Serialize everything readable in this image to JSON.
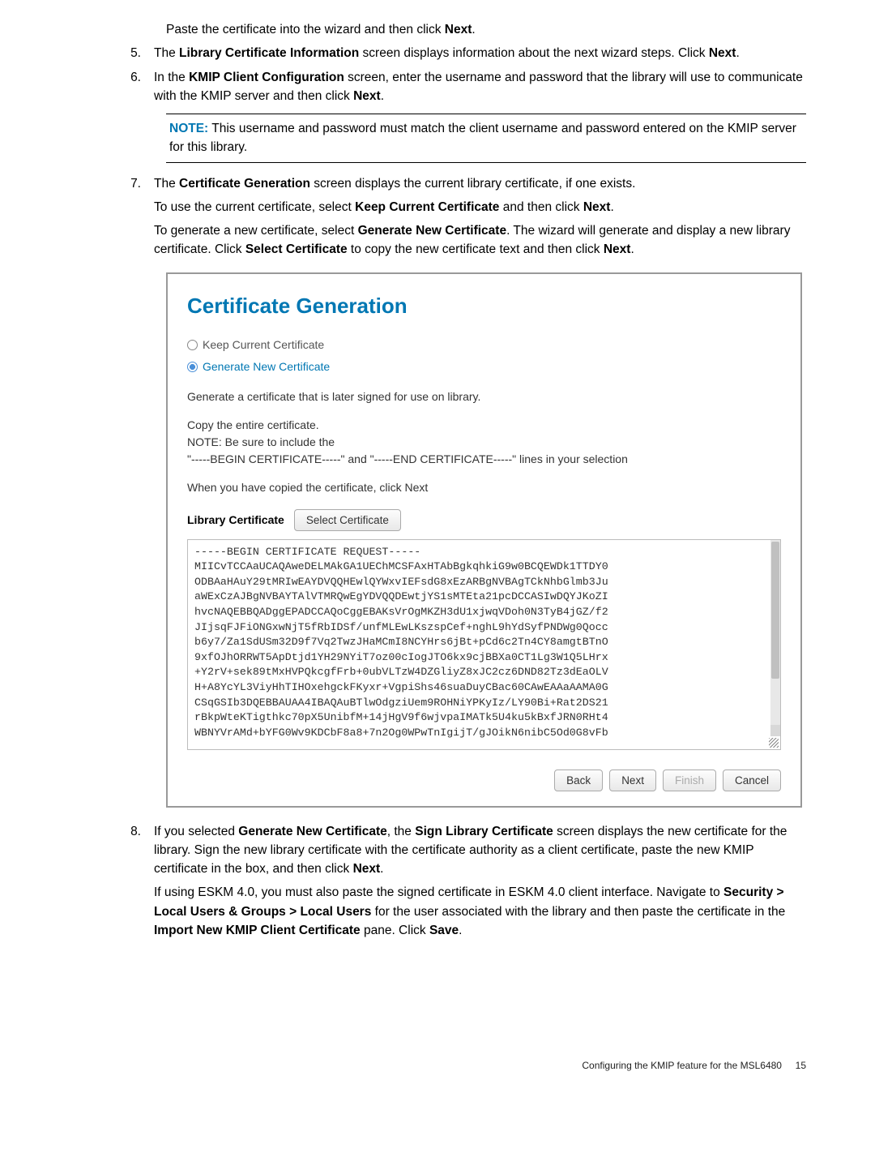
{
  "intro": {
    "t1": "Paste the certificate into the wizard and then click ",
    "next": "Next",
    "t2": "."
  },
  "item5": {
    "num": "5.",
    "t1": "The ",
    "b1": "Library Certificate Information",
    "t2": " screen displays information about the next wizard steps. Click ",
    "b2": "Next",
    "t3": "."
  },
  "item6": {
    "num": "6.",
    "t1": "In the ",
    "b1": "KMIP Client Configuration",
    "t2": " screen, enter the username and password that the library will use to communicate with the KMIP server and then click ",
    "b2": "Next",
    "t3": "."
  },
  "note": {
    "label": "NOTE:",
    "text": " This username and password must match the client username and password entered on the KMIP server for this library."
  },
  "item7": {
    "num": "7.",
    "line1_t1": "The ",
    "line1_b1": "Certificate Generation",
    "line1_t2": " screen displays the current library certificate, if one exists.",
    "line2_t1": "To use the current certificate, select ",
    "line2_b1": "Keep Current Certificate",
    "line2_t2": " and then click ",
    "line2_b2": "Next",
    "line2_t3": ".",
    "line3_t1": "To generate a new certificate, select ",
    "line3_b1": "Generate New Certificate",
    "line3_t2": ". The wizard will generate and display a new library certificate. Click ",
    "line3_b2": "Select Certificate",
    "line3_t3": " to copy the new certificate text and then click ",
    "line3_b3": "Next",
    "line3_t4": "."
  },
  "cert": {
    "title": "Certificate Generation",
    "radio_keep": "Keep Current Certificate",
    "radio_gen": "Generate New Certificate",
    "sub1": "Generate a certificate that is later signed for use on library.",
    "sub2": "Copy the entire certificate.",
    "sub3": "NOTE: Be sure to include the",
    "sub4": "\"-----BEGIN CERTIFICATE-----\" and \"-----END CERTIFICATE-----\" lines in your selection",
    "sub5": "When you have copied the certificate, click Next",
    "libcert_label": "Library Certificate",
    "select_btn": "Select Certificate",
    "text": [
      "-----BEGIN CERTIFICATE REQUEST-----",
      "MIICvTCCAaUCAQAweDELMAkGA1UEChMCSFAxHTAbBgkqhkiG9w0BCQEWDk1TTDY0",
      "ODBAaHAuY29tMRIwEAYDVQQHEwlQYWxvIEFsdG8xEzARBgNVBAgTCkNhbGlmb3Ju",
      "aWExCzAJBgNVBAYTAlVTMRQwEgYDVQQDEwtjYS1sMTEta21pcDCCASIwDQYJKoZI",
      "hvcNAQEBBQADggEPADCCAQoCggEBAKsVrOgMKZH3dU1xjwqVDoh0N3TyB4jGZ/f2",
      "JIjsqFJFiONGxwNjT5fRbIDSf/unfMLEwLKszspCef+nghL9hYdSyfPNDWg0Qocc",
      "b6y7/Za1SdUSm32D9f7Vq2TwzJHaMCmI8NCYHrs6jBt+pCd6c2Tn4CY8amgtBTnO",
      "9xfOJhORRWT5ApDtjd1YH29NYiT7oz00cIogJTO6kx9cjBBXa0CT1Lg3W1Q5LHrx",
      "+Y2rV+sek89tMxHVPQkcgfFrb+0ubVLTzW4DZGliyZ8xJC2cz6DND82Tz3dEaOLV",
      "H+A8YcYL3ViyHhTIHOxehgckFKyxr+VgpiShs46suaDuyCBac60CAwEAAaAAMA0G",
      "CSqGSIb3DQEBBAUAA4IBAQAuBTlwOdgziUem9ROHNiYPKyIz/LY90Bi+Rat2DS21",
      "rBkpWteKTigthkc70pX5UnibfM+14jHgV9f6wjvpaIMATk5U4ku5kBxfJRN0RHt4",
      "WBNYVrAMd+bYFG0Wv9KDCbF8a8+7n2Og0WPwTnIgijT/gJOikN6nibC5Od0G8vFb"
    ],
    "btn_back": "Back",
    "btn_next": "Next",
    "btn_finish": "Finish",
    "btn_cancel": "Cancel"
  },
  "item8": {
    "num": "8.",
    "t1": "If you selected ",
    "b1": "Generate New Certificate",
    "t2": ", the ",
    "b2": "Sign Library Certificate",
    "t3": " screen displays the new certificate for the library. Sign the new library certificate with the certificate authority as a client certificate, paste the new KMIP certificate in the box, and then click ",
    "b3": "Next",
    "t4": ".",
    "p2_t1": "If using ESKM 4.0, you must also paste the signed certificate in ESKM 4.0 client interface. Navigate to ",
    "p2_b1": "Security > Local Users & Groups > Local Users",
    "p2_t2": " for the user associated with the library and then paste the certificate in the ",
    "p2_b2": "Import New KMIP Client Certificate",
    "p2_t3": " pane. Click ",
    "p2_b3": "Save",
    "p2_t4": "."
  },
  "footer": {
    "text": "Configuring the KMIP feature for the MSL6480",
    "page": "15"
  }
}
